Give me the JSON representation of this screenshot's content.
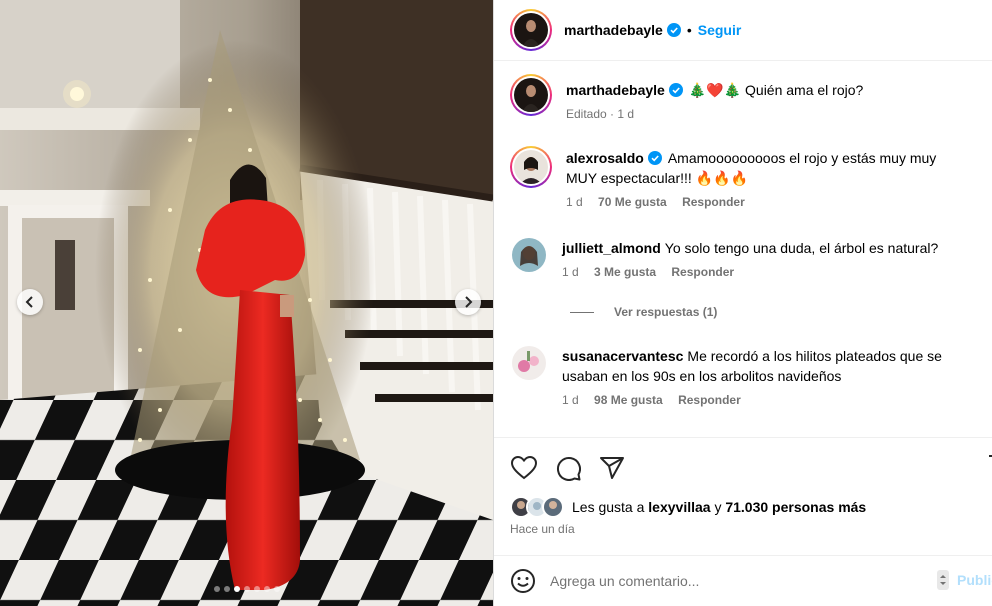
{
  "post": {
    "username": "marthadebayle",
    "follow_label": "Seguir",
    "separator": "•",
    "caption": {
      "username": "marthadebayle",
      "text": "🎄❤️🎄 Quién ama el rojo?",
      "meta": "Editado · 1 d"
    },
    "carousel": {
      "total_slides": 7,
      "active_slide": 3
    }
  },
  "comments": [
    {
      "username": "alexrosaldo",
      "verified": true,
      "text": "Amamooooooooos el rojo y estás muy muy MUY espectacular!!! 🔥🔥🔥",
      "time": "1 d",
      "likes": "70 Me gusta",
      "reply_label": "Responder"
    },
    {
      "username": "julliett_almond",
      "verified": false,
      "text": "Yo solo tengo una duda, el árbol es natural?",
      "time": "1 d",
      "likes": "3 Me gusta",
      "reply_label": "Responder",
      "view_replies": "Ver respuestas (1)"
    },
    {
      "username": "susanacervantesc",
      "verified": false,
      "text": "Me recordó a los hilitos plateados que se usaban en los 90s en los arbolitos navideños",
      "time": "1 d",
      "likes": "98 Me gusta",
      "reply_label": "Responder"
    }
  ],
  "likes_summary": {
    "prefix": "Les gusta a",
    "user": "lexyvillaa",
    "connector": "y",
    "others": "71.030 personas más"
  },
  "time_ago": "Hace un día",
  "add_comment": {
    "placeholder": "Agrega un comentario...",
    "publish_label": "Publicar"
  },
  "icons": {
    "like": "heart-icon",
    "comment": "comment-bubble-icon",
    "share": "paper-plane-icon",
    "save": "bookmark-icon",
    "emoji": "smiley-icon",
    "verified": "verified-badge-icon",
    "prev": "chevron-left-icon",
    "next": "chevron-right-icon"
  },
  "colors": {
    "accent": "#0095f6",
    "verified": "#0095f6",
    "muted": "#737373",
    "dress": "#e3201b"
  }
}
